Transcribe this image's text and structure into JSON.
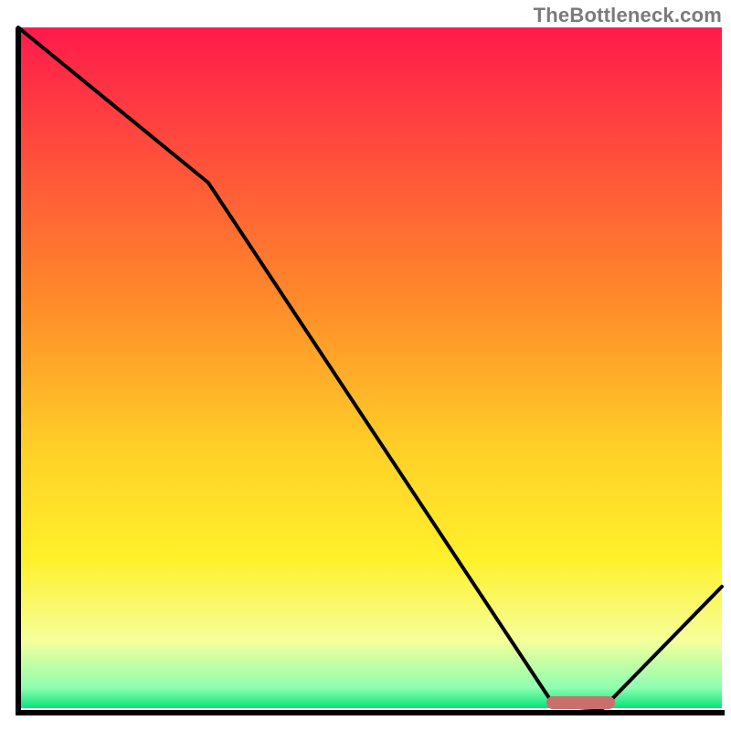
{
  "watermark": "TheBottleneck.com",
  "chart_data": {
    "type": "line",
    "title": "",
    "xlabel": "",
    "ylabel": "",
    "xlim": [
      0,
      100
    ],
    "ylim": [
      0,
      100
    ],
    "x": [
      0,
      27,
      76,
      85,
      100
    ],
    "values": [
      100,
      77,
      1,
      1,
      18
    ],
    "optimal_marker": {
      "x_start": 76,
      "x_end": 85,
      "y": 1
    },
    "gradient_stops": [
      {
        "pct": 0,
        "color": "#ff1a4b"
      },
      {
        "pct": 40,
        "color": "#ff8a2a"
      },
      {
        "pct": 62,
        "color": "#ffd028"
      },
      {
        "pct": 78,
        "color": "#fff02a"
      },
      {
        "pct": 90,
        "color": "#f6ff9a"
      },
      {
        "pct": 97,
        "color": "#8dffb0"
      },
      {
        "pct": 100,
        "color": "#06e47a"
      }
    ],
    "notes": "No tick labels or axis text are visible; values estimated from pixel positions. y=100 corresponds to top of plot, y=0 to bottom axis."
  }
}
